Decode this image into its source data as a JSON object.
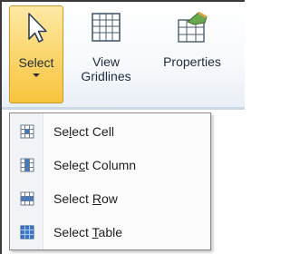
{
  "ribbon": {
    "select": {
      "label": "Select",
      "icon": "cursor-arrow-icon",
      "state": "pressed"
    },
    "view_gridlines": {
      "label_line1": "View",
      "label_line2": "Gridlines",
      "icon": "table-grid-icon"
    },
    "properties": {
      "label": "Properties",
      "icon": "table-properties-icon"
    }
  },
  "menu": {
    "items": [
      {
        "pre": "Se",
        "accel": "l",
        "post": "ect Cell",
        "icon": "select-cell-icon"
      },
      {
        "pre": "Sele",
        "accel": "c",
        "post": "t Column",
        "icon": "select-column-icon"
      },
      {
        "pre": "Select ",
        "accel": "R",
        "post": "ow",
        "icon": "select-row-icon"
      },
      {
        "pre": "Select ",
        "accel": "T",
        "post": "able",
        "icon": "select-table-icon"
      }
    ]
  },
  "colors": {
    "select_highlight": "#fbd873",
    "menu_gutter": "#f1f3f6",
    "icon_blue": "#3f78c5"
  }
}
